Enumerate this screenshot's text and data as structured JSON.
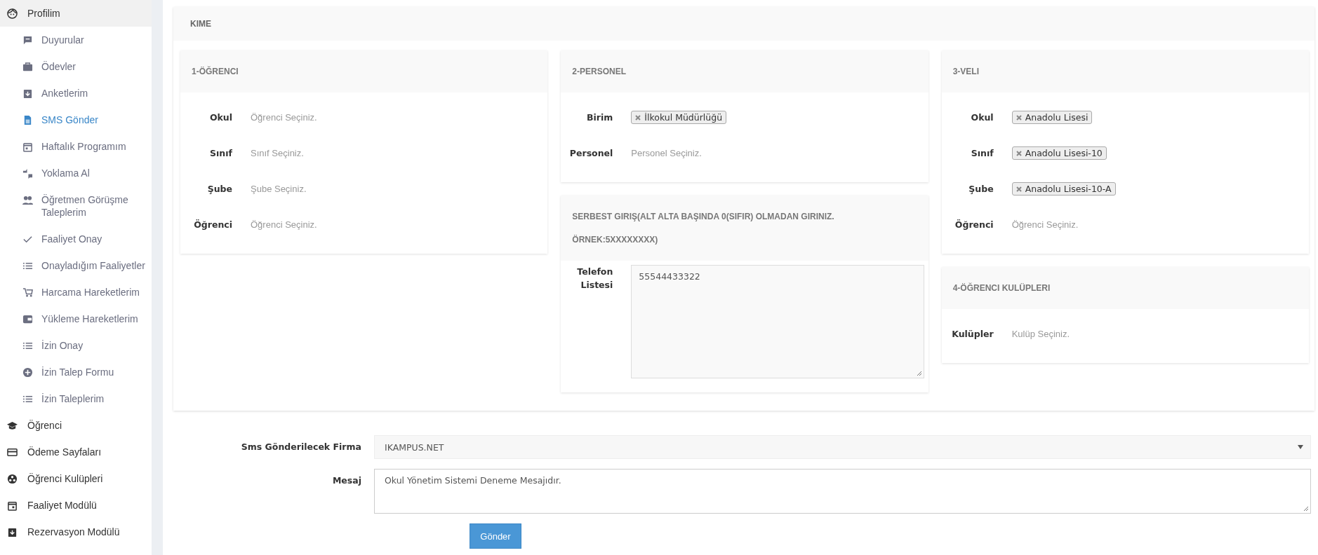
{
  "sidebar": {
    "items": [
      {
        "label": "Profilim",
        "expanded": true,
        "children": [
          {
            "label": "Duyurular",
            "selected": false
          },
          {
            "label": "Ödevler",
            "selected": false
          },
          {
            "label": "Anketlerim",
            "selected": false
          },
          {
            "label": "SMS Gönder",
            "selected": true
          },
          {
            "label": "Haftalık Programım",
            "selected": false
          },
          {
            "label": "Yoklama Al",
            "selected": false
          },
          {
            "label": "Öğretmen Görüşme Taleplerim",
            "selected": false
          },
          {
            "label": "Faaliyet Onay",
            "selected": false
          },
          {
            "label": "Onayladığım Faaliyetler",
            "selected": false
          },
          {
            "label": "Harcama Hareketlerim",
            "selected": false
          },
          {
            "label": "Yükleme Hareketlerim",
            "selected": false
          },
          {
            "label": "İzin Onay",
            "selected": false
          },
          {
            "label": "İzin Talep Formu",
            "selected": false
          },
          {
            "label": "İzin Taleplerim",
            "selected": false
          }
        ]
      },
      {
        "label": "Öğrenci",
        "expanded": false
      },
      {
        "label": "Ödeme Sayfaları",
        "expanded": false
      },
      {
        "label": "Öğrenci Kulüpleri",
        "expanded": false
      },
      {
        "label": "Faaliyet Modülü",
        "expanded": false
      },
      {
        "label": "Rezervasyon Modülü",
        "expanded": false
      }
    ]
  },
  "recipients": {
    "title": "KIME",
    "columns": [
      [
        {
          "title": "1-ÖĞRENCI",
          "fields": [
            {
              "label": "Okul",
              "kind": "select",
              "placeholder": "Öğrenci Seçiniz."
            },
            {
              "label": "Sınıf",
              "kind": "select",
              "placeholder": "Sınıf Seçiniz."
            },
            {
              "label": "Şube",
              "kind": "select",
              "placeholder": "Şube Seçiniz."
            },
            {
              "label": "Öğrenci",
              "kind": "select",
              "placeholder": "Öğrenci Seçiniz."
            }
          ]
        }
      ],
      [
        {
          "title": "2-PERSONEL",
          "fields": [
            {
              "label": "Birim",
              "kind": "tags",
              "tags": [
                "İlkokul Müdürlüğü"
              ]
            },
            {
              "label": "Personel",
              "kind": "select",
              "placeholder": "Personel Seçiniz."
            }
          ]
        },
        {
          "title": "SERBEST GIRIŞ(ALT ALTA BAŞINDA 0(SIFIR) OLMADAN GIRINIZ. ÖRNEK:5XXXXXXXX)",
          "fields": [
            {
              "label": "Telefon Listesi",
              "kind": "textarea",
              "value": "55544433322"
            }
          ]
        }
      ],
      [
        {
          "title": "3-VELI",
          "fields": [
            {
              "label": "Okul",
              "kind": "tags",
              "tags": [
                "Anadolu Lisesi"
              ]
            },
            {
              "label": "Sınıf",
              "kind": "tags",
              "tags": [
                "Anadolu Lisesi-10"
              ]
            },
            {
              "label": "Şube",
              "kind": "tags",
              "tags": [
                "Anadolu Lisesi-10-A"
              ]
            },
            {
              "label": "Öğrenci",
              "kind": "select",
              "placeholder": "Öğrenci Seçiniz."
            }
          ]
        },
        {
          "title": "4-ÖĞRENCI KULÜPLERI",
          "fields": [
            {
              "label": "Kulüpler",
              "kind": "select",
              "placeholder": "Kulüp Seçiniz."
            }
          ]
        }
      ]
    ]
  },
  "form": {
    "fields": [
      {
        "label": "Sms Gönderilecek Firma",
        "kind": "dropdown",
        "value": "IKAMPUS.NET"
      },
      {
        "label": "Mesaj",
        "kind": "textarea",
        "value": "Okul Yönetim Sistemi Deneme Mesajıdır."
      }
    ],
    "submit": "Gönder"
  }
}
